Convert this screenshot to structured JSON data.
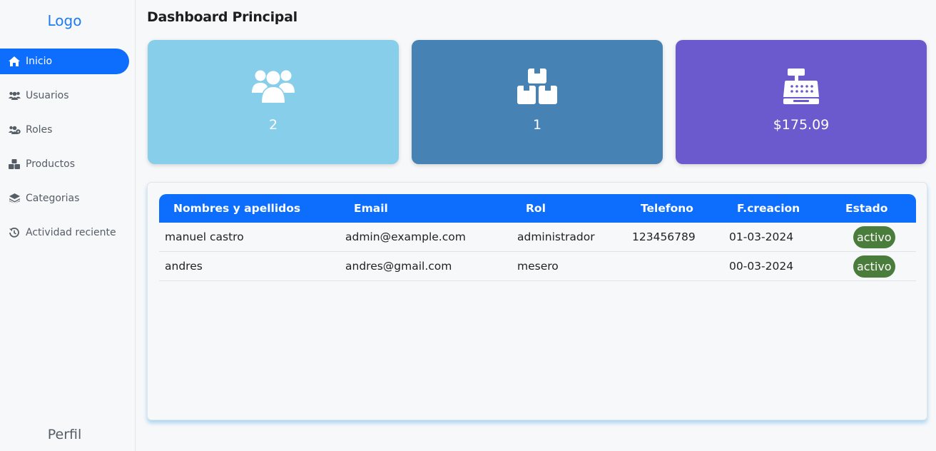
{
  "sidebar": {
    "logo": "Logo",
    "items": [
      {
        "label": "Inicio",
        "icon": "home-icon",
        "active": true
      },
      {
        "label": "Usuarios",
        "icon": "users-icon"
      },
      {
        "label": "Roles",
        "icon": "users-cog-icon"
      },
      {
        "label": "Productos",
        "icon": "boxes-icon"
      },
      {
        "label": "Categorias",
        "icon": "layers-icon"
      },
      {
        "label": "Actividad reciente",
        "icon": "history-icon"
      }
    ],
    "perfil": "Perfil"
  },
  "header": {
    "title": "Dashboard Principal"
  },
  "cards": [
    {
      "value": "2",
      "icon": "users-icon",
      "color": "#87ceeb"
    },
    {
      "value": "1",
      "icon": "boxes-icon",
      "color": "#4682b4"
    },
    {
      "value": "$175.09",
      "icon": "cash-register-icon",
      "color": "#6a5acd"
    }
  ],
  "table": {
    "headers": [
      "Nombres y apellidos",
      "Email",
      "Rol",
      "Telefono",
      "F.creacion",
      "Estado"
    ],
    "rows": [
      {
        "name": "manuel castro",
        "email": "admin@example.com",
        "rol": "administrador",
        "telefono": "123456789",
        "fecha": "01-03-2024",
        "estado": "activo"
      },
      {
        "name": "andres",
        "email": "andres@gmail.com",
        "rol": "mesero",
        "telefono": "",
        "fecha": "00-03-2024",
        "estado": "activo"
      }
    ]
  },
  "colors": {
    "accent": "#0d6efd",
    "badge": "#4a7c3c"
  }
}
